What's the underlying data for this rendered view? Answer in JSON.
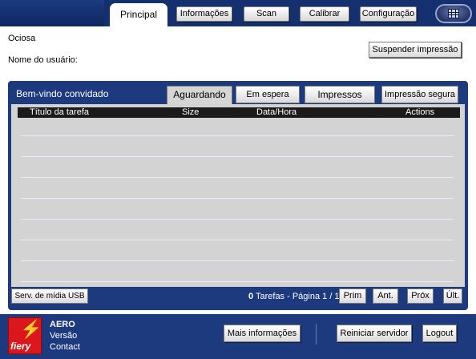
{
  "nav": {
    "active_tab": "Principal",
    "buttons": [
      "Informações",
      "Scan",
      "Calibrar",
      "Configuração"
    ],
    "grid_icon": "grid-icon"
  },
  "status": {
    "state": "Ociosa",
    "username_label": "Nome do usuário:"
  },
  "actions": {
    "suspend_label": "Suspender impressão"
  },
  "jobs": {
    "welcome": "Bem-vindo convidado",
    "tabs": [
      "Aguardando",
      "Em espera",
      "Impressos",
      "Impressão segura"
    ],
    "active_tab_index": 0,
    "columns": [
      "Título da tarefa",
      "Size",
      "Data/Hora",
      "Actions"
    ],
    "rows": []
  },
  "pager": {
    "usb_label": "Serv. de mídia USB",
    "count": "0",
    "info": "Tarefas - Página 1 / 1",
    "first": "Prim",
    "prev": "Ant.",
    "next": "Próx",
    "last": "Últ."
  },
  "footer": {
    "logo_text": "fiery",
    "product": "AERO",
    "version_label": "Versão",
    "contact_label": "Contact",
    "more_info": "Mais informações",
    "restart": "Reiniciar servidor",
    "logout": "Logout"
  },
  "colors": {
    "navy": "#1d3a7e",
    "top_bar": "#15306e",
    "table_bg": "#d3d3d3",
    "logo_red": "#d9171c"
  }
}
